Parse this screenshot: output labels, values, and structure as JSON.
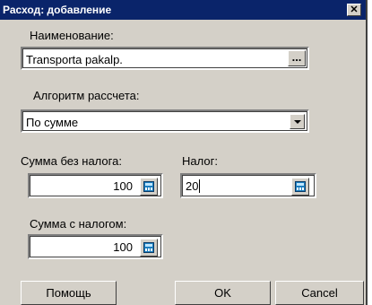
{
  "window": {
    "title": "Расход: добавление",
    "close_glyph": "✕"
  },
  "name_field": {
    "label": "Наименование:",
    "value": "Transporta pakalp.",
    "browse_label": "..."
  },
  "algorithm": {
    "label": "Алгоритм рассчета:",
    "selected": "По сумме"
  },
  "amount_without_tax": {
    "label": "Сумма без налога:",
    "value": "100"
  },
  "tax": {
    "label": "Налог:",
    "value": "20"
  },
  "amount_with_tax": {
    "label": "Сумма с налогом:",
    "value": "100"
  },
  "buttons": {
    "help": "Помощь",
    "ok": "OK",
    "cancel": "Cancel"
  },
  "icons": {
    "calculator": "calculator-icon",
    "dropdown": "chevron-down-icon",
    "close": "close-icon"
  }
}
